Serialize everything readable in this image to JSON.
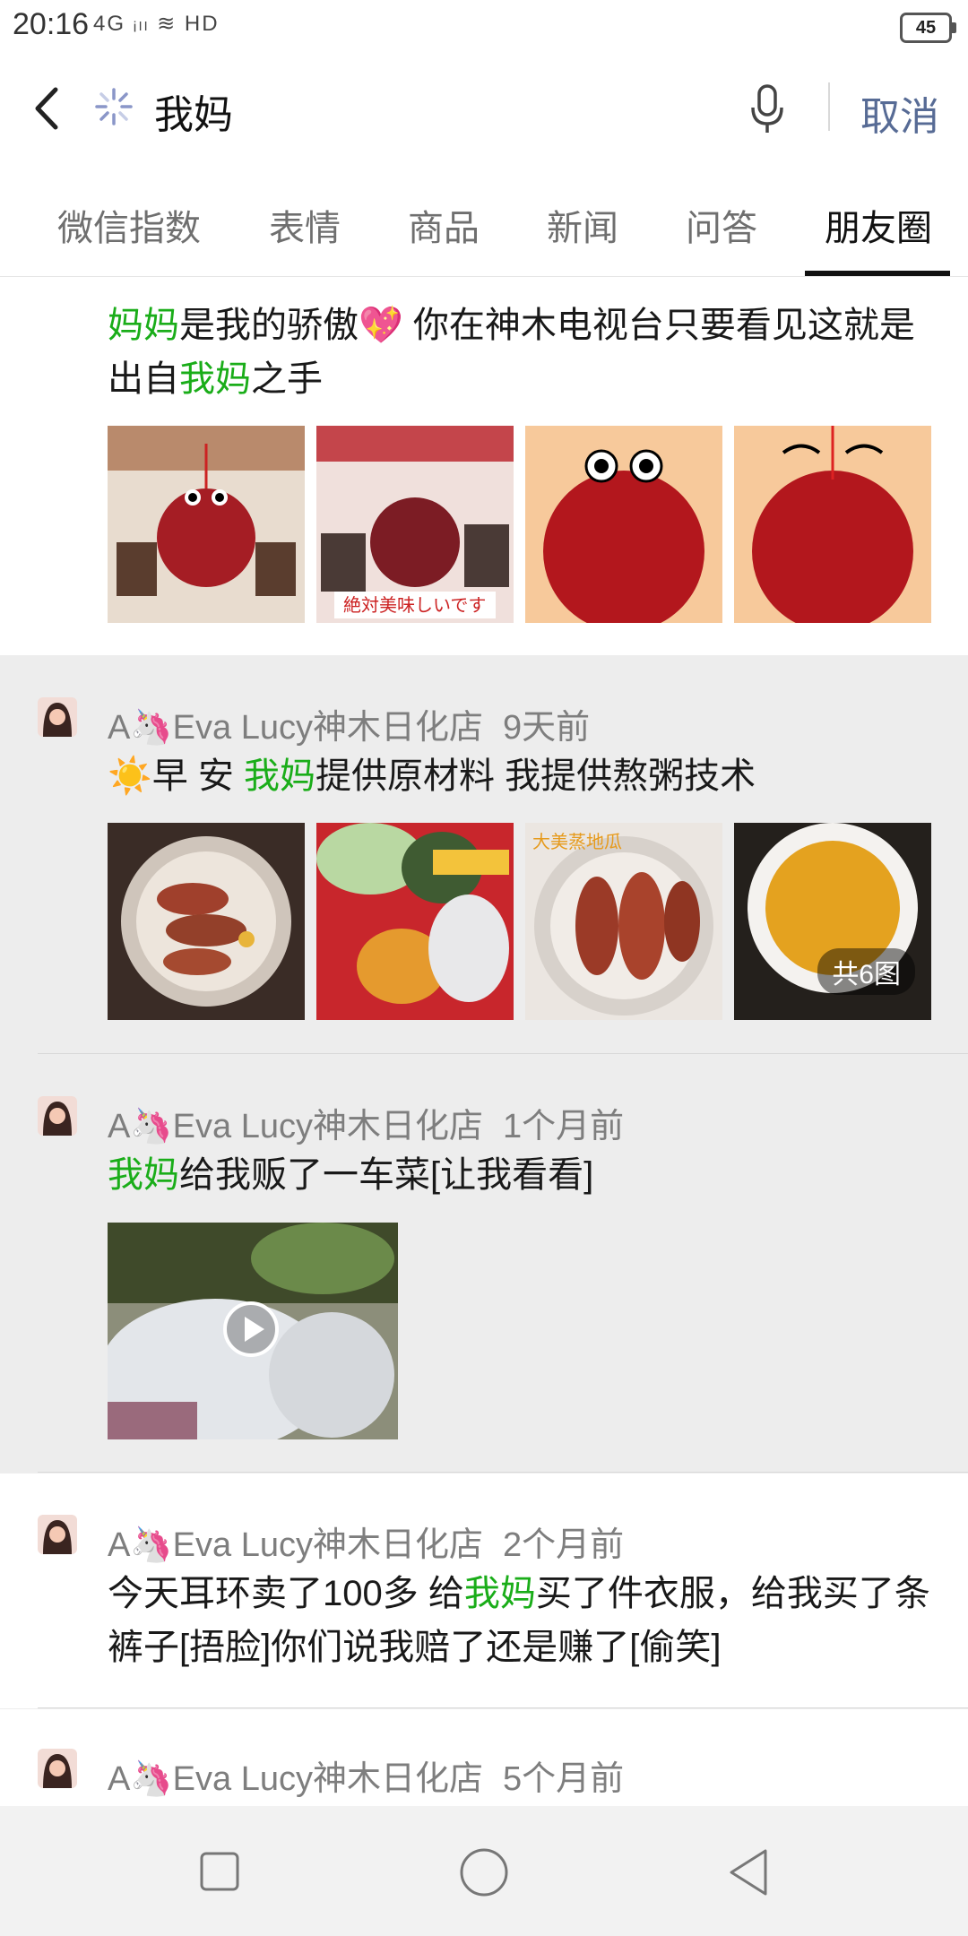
{
  "status_bar": {
    "time": "20:16",
    "signal": "4G ᵢₗₗ ≋ HD",
    "battery": "45"
  },
  "search_bar": {
    "query": "我妈",
    "cancel_label": "取消"
  },
  "tabs": [
    {
      "label": "微信指数",
      "active": false
    },
    {
      "label": "表情",
      "active": false
    },
    {
      "label": "商品",
      "active": false
    },
    {
      "label": "新闻",
      "active": false
    },
    {
      "label": "问答",
      "active": false
    },
    {
      "label": "朋友圈",
      "active": true
    }
  ],
  "posts": [
    {
      "text_segments": [
        {
          "t": "妈妈",
          "h": true
        },
        {
          "t": "是我的骄傲💖 你在神木电视台只要看见这就是出自",
          "h": false
        },
        {
          "t": "我妈",
          "h": true
        },
        {
          "t": "之手",
          "h": false
        }
      ]
    },
    {
      "author": "A🦄Eva Lucy神木日化店",
      "time": "9天前",
      "text_segments": [
        {
          "t": "☀️早 安 ",
          "h": false
        },
        {
          "t": "我妈",
          "h": true
        },
        {
          "t": "提供原材料 我提供熬粥技术",
          "h": false
        }
      ],
      "image_count_badge": "共6图"
    },
    {
      "author": "A🦄Eva Lucy神木日化店",
      "time": "1个月前",
      "text_segments": [
        {
          "t": "我妈",
          "h": true
        },
        {
          "t": "给我贩了一车菜[让我看看]",
          "h": false
        }
      ]
    },
    {
      "author": "A🦄Eva Lucy神木日化店",
      "time": "2个月前",
      "text_segments": [
        {
          "t": "今天耳环卖了100多 给",
          "h": false
        },
        {
          "t": "我妈",
          "h": true
        },
        {
          "t": "买了件衣服，给我买了条裤子[捂脸]你们说我赔了还是赚了[偷笑]",
          "h": false
        }
      ]
    },
    {
      "author": "A🦄Eva Lucy神木日化店",
      "time": "5个月前"
    }
  ],
  "colors": {
    "highlight": "#1aad19",
    "link": "#576b95",
    "background": "#ededed"
  },
  "icons": [
    "back-arrow-icon",
    "loading-spinner-icon",
    "microphone-icon",
    "play-icon",
    "square-nav-icon",
    "circle-home-icon",
    "triangle-back-icon"
  ]
}
